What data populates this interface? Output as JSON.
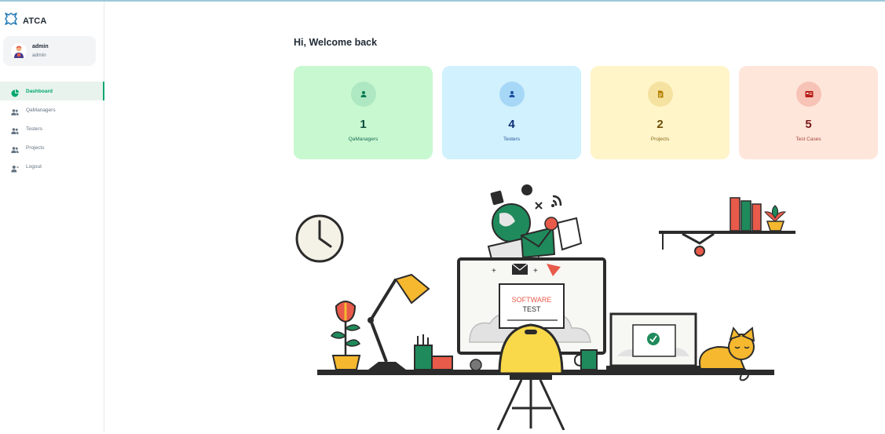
{
  "app": {
    "name": "ATCA"
  },
  "account": {
    "name": "admin",
    "role": "admin"
  },
  "nav": [
    {
      "label": "Dashboard",
      "icon": "pie-chart-icon",
      "active": true
    },
    {
      "label": "QaManagers",
      "icon": "users-icon"
    },
    {
      "label": "Testers",
      "icon": "users-icon"
    },
    {
      "label": "Projects",
      "icon": "users-icon"
    },
    {
      "label": "Logout",
      "icon": "user-logout-icon"
    }
  ],
  "main": {
    "greeting": "Hi, Welcome back",
    "cards": [
      {
        "value": "1",
        "label": "QaManagers",
        "icon": "user-icon",
        "color": "#c8f8d0"
      },
      {
        "value": "4",
        "label": "Testers",
        "icon": "user-icon",
        "color": "#d0f1fd"
      },
      {
        "value": "2",
        "label": "Projects",
        "icon": "document-icon",
        "color": "#fff5c9"
      },
      {
        "value": "5",
        "label": "Test Cases",
        "icon": "test-case-icon",
        "color": "#ffe6db"
      }
    ],
    "illustration": {
      "screen_title": "SOFTWARE",
      "screen_subtitle": "TEST"
    }
  },
  "colors": {
    "accent": "#00a76f",
    "topline": "#9ec9d9"
  }
}
